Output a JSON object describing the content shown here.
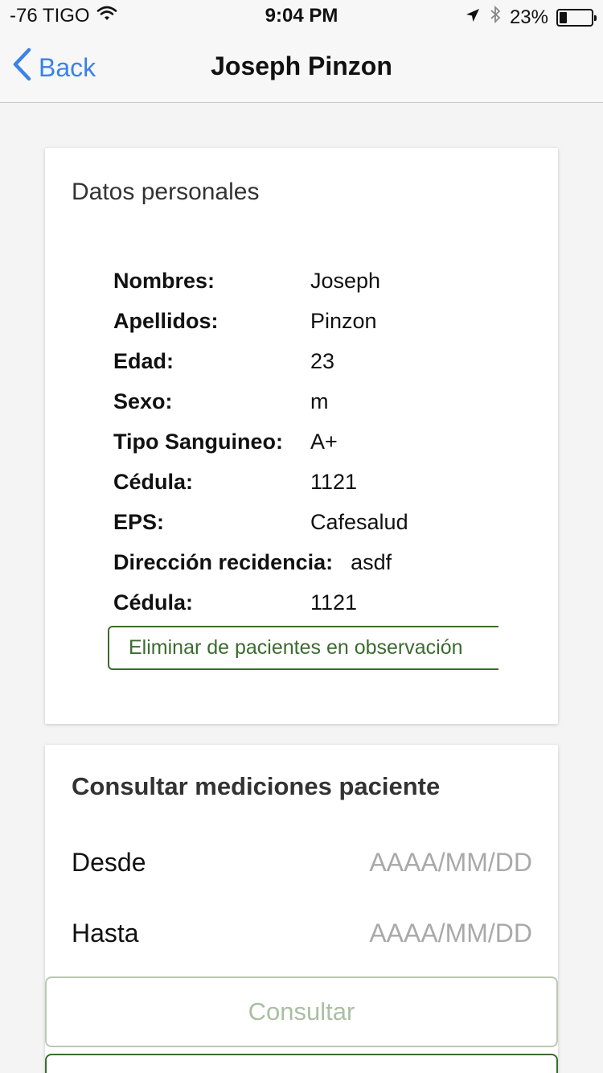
{
  "status_bar": {
    "carrier": "-76 TIGO",
    "time": "9:04 PM",
    "battery": "23%",
    "battery_level": 0.23,
    "icons": [
      "wifi-icon",
      "location-arrow-icon",
      "bluetooth-icon",
      "battery-icon"
    ]
  },
  "nav": {
    "back_label": "Back",
    "title": "Joseph Pinzon"
  },
  "personal": {
    "title": "Datos personales",
    "rows": [
      {
        "label": "Nombres:",
        "value": "Joseph"
      },
      {
        "label": "Apellidos:",
        "value": "Pinzon"
      },
      {
        "label": "Edad:",
        "value": "23"
      },
      {
        "label": "Sexo:",
        "value": "m"
      },
      {
        "label": "Tipo Sanguineo:",
        "value": "A+"
      },
      {
        "label": "Cédula:",
        "value": "1121"
      },
      {
        "label": "EPS:",
        "value": "Cafesalud"
      },
      {
        "label": "Dirección recidencia:",
        "value": "asdf"
      },
      {
        "label": "Cédula:",
        "value": "1121"
      }
    ],
    "eliminar_label": "Eliminar de pacientes en observación"
  },
  "consulta": {
    "title": "Consultar mediciones paciente",
    "desde_label": "Desde",
    "desde_placeholder": "AAAA/MM/DD",
    "hasta_label": "Hasta",
    "hasta_placeholder": "AAAA/MM/DD",
    "consultar_label": "Consultar"
  },
  "colors": {
    "accent_blue": "#3b82e6",
    "green": "#3c6b2f",
    "green_disabled": "#a9bfa3"
  }
}
